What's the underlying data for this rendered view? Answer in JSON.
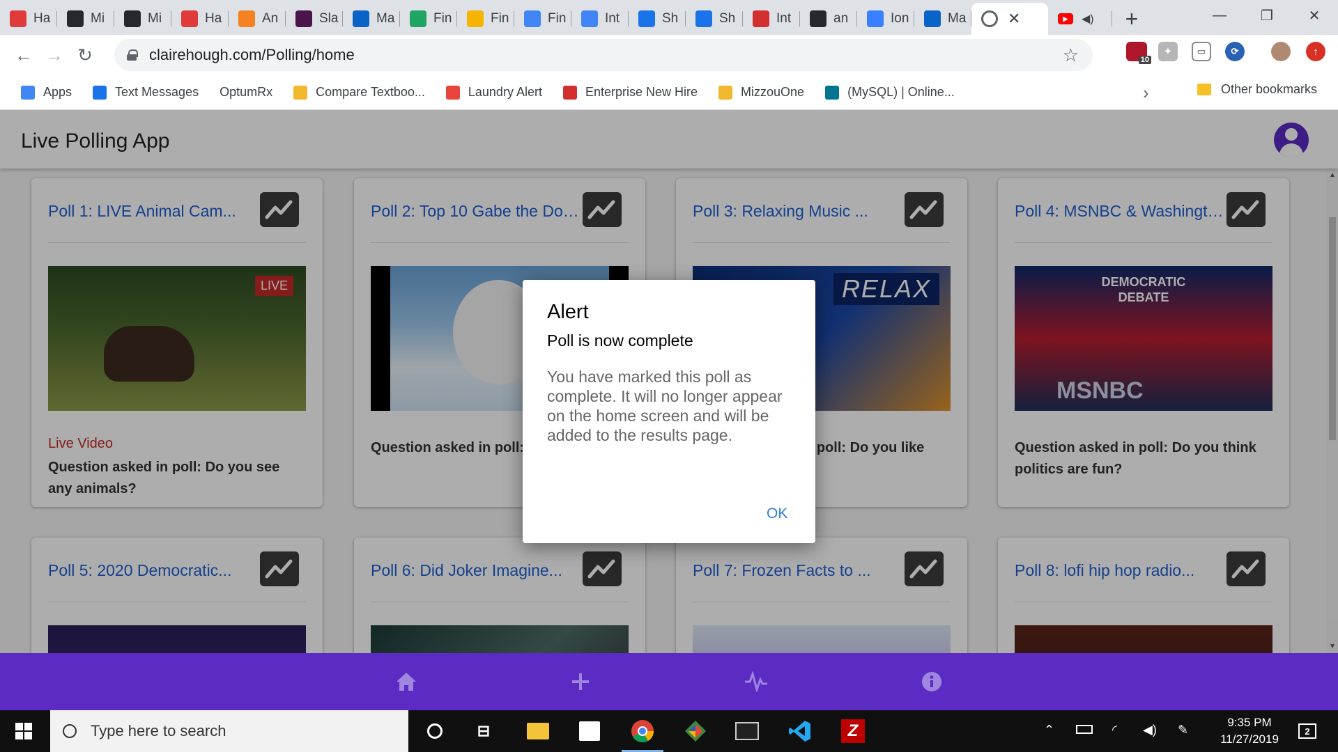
{
  "browser": {
    "tabs": [
      {
        "title": "Ha",
        "icon": "canvas-icon",
        "color": "#e03b3b"
      },
      {
        "title": "Mi",
        "icon": "github-icon",
        "color": "#24292e"
      },
      {
        "title": "Mi",
        "icon": "github-icon",
        "color": "#24292e"
      },
      {
        "title": "Ha",
        "icon": "canvas-icon",
        "color": "#e03b3b"
      },
      {
        "title": "An",
        "icon": "box-icon",
        "color": "#f58220"
      },
      {
        "title": "Sla",
        "icon": "slack-icon",
        "color": "#4a154b"
      },
      {
        "title": "Ma",
        "icon": "outlook-icon",
        "color": "#0a64c8"
      },
      {
        "title": "Fin",
        "icon": "drive-icon",
        "color": "#1fa463"
      },
      {
        "title": "Fin",
        "icon": "slides-icon",
        "color": "#f4b400"
      },
      {
        "title": "Fin",
        "icon": "docs-icon",
        "color": "#4285f4"
      },
      {
        "title": "Int",
        "icon": "docs-icon",
        "color": "#4285f4"
      },
      {
        "title": "Sh",
        "icon": "messages-icon",
        "color": "#1a73e8"
      },
      {
        "title": "Sh",
        "icon": "messages-icon",
        "color": "#1a73e8"
      },
      {
        "title": "Int",
        "icon": "info-i-icon",
        "color": "#d32f2f"
      },
      {
        "title": "an",
        "icon": "github-icon",
        "color": "#24292e"
      },
      {
        "title": "Ion",
        "icon": "ionic-icon",
        "color": "#3880ff"
      },
      {
        "title": "Ma",
        "icon": "outlook-icon",
        "color": "#0a64c8"
      }
    ],
    "active_tab_icon": "globe-icon",
    "active_tab_close": "✕",
    "new_tab_label": "+",
    "url": "clairehough.com/Polling/home",
    "extension_badge": "10",
    "bookmarks": [
      {
        "label": "Apps",
        "icon": "apps-grid-icon",
        "color": "#4285f4"
      },
      {
        "label": "Text Messages",
        "icon": "messages-icon",
        "color": "#1a73e8"
      },
      {
        "label": "OptumRx",
        "icon": "",
        "color": ""
      },
      {
        "label": "Compare Textboo...",
        "icon": "mizzou-icon",
        "color": "#f1b82d"
      },
      {
        "label": "Laundry Alert",
        "icon": "laundry-icon",
        "color": "#e8453c"
      },
      {
        "label": "Enterprise New Hire",
        "icon": "info-i-icon",
        "color": "#d32f2f"
      },
      {
        "label": "MizzouOne",
        "icon": "mizzou-icon",
        "color": "#f1b82d"
      },
      {
        "label": "(MySQL) | Online...",
        "icon": "mysql-icon",
        "color": "#00758f"
      }
    ],
    "other_bookmarks": "Other bookmarks"
  },
  "app": {
    "title": "Live Polling App",
    "accent": "#5b2bc4",
    "polls": [
      {
        "title": "Poll 1: LIVE Animal Cam...",
        "live_label": "Live Video",
        "question": "Question asked in poll: Do you see any animals?",
        "thumb_text": "LIVE"
      },
      {
        "title": "Poll 2: Top 10 Gabe the Dog...",
        "live_label": "",
        "question": "Question asked in poll: Do you like",
        "thumb_text": ""
      },
      {
        "title": "Poll 3: Relaxing Music ...",
        "live_label": "",
        "question": "Question asked in poll: Do you like",
        "thumb_text": "RELAX"
      },
      {
        "title": "Poll 4: MSNBC & Washington...",
        "live_label": "",
        "question": "Question asked in poll: Do you think politics are fun?",
        "thumb_text": "DEMOCRATIC DEBATE"
      },
      {
        "title": "Poll 5: 2020 Democratic...",
        "live_label": "",
        "question": "",
        "thumb_text": ""
      },
      {
        "title": "Poll 6: Did Joker Imagine...",
        "live_label": "",
        "question": "",
        "thumb_text": ""
      },
      {
        "title": "Poll 7: Frozen Facts to ...",
        "live_label": "",
        "question": "",
        "thumb_text": ""
      },
      {
        "title": "Poll 8: lofi hip hop radio...",
        "live_label": "",
        "question": "",
        "thumb_text": ""
      }
    ],
    "thumb_brand": "MSNBC",
    "nav": [
      "home-icon",
      "add-icon",
      "activity-icon",
      "info-icon"
    ]
  },
  "dialog": {
    "header": "Alert",
    "subheader": "Poll is now complete",
    "message": "You have marked this poll as complete. It will no longer appear on the home screen and will be added to the results page.",
    "ok_label": "OK"
  },
  "taskbar": {
    "search_placeholder": "Type here to search",
    "time": "9:35 PM",
    "date": "11/27/2019",
    "notification_count": "2"
  }
}
